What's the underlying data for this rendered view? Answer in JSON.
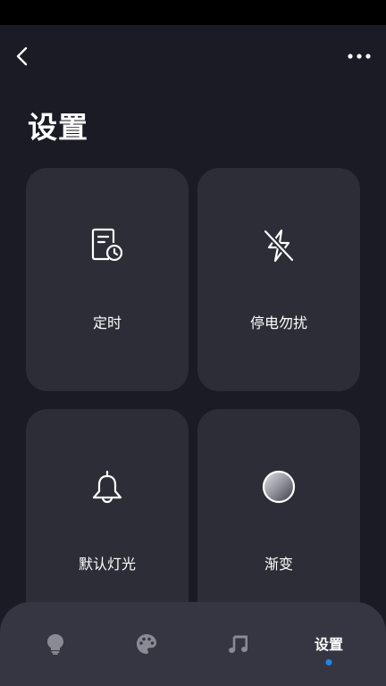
{
  "page": {
    "title": "设置"
  },
  "cards": [
    {
      "id": "timer",
      "label": "定时",
      "icon": "timer-doc-icon"
    },
    {
      "id": "dnd",
      "label": "停电勿扰",
      "icon": "flash-off-icon"
    },
    {
      "id": "default_light",
      "label": "默认灯光",
      "icon": "bell-icon"
    },
    {
      "id": "gradient",
      "label": "渐变",
      "icon": "gradient-circle-icon"
    }
  ],
  "bottom_nav": {
    "active_label": "设置",
    "items": [
      {
        "icon": "lightbulb-icon"
      },
      {
        "icon": "palette-icon"
      },
      {
        "icon": "music-icon"
      },
      {
        "label": "设置"
      }
    ],
    "active_dot_color": "#1e88e5"
  }
}
